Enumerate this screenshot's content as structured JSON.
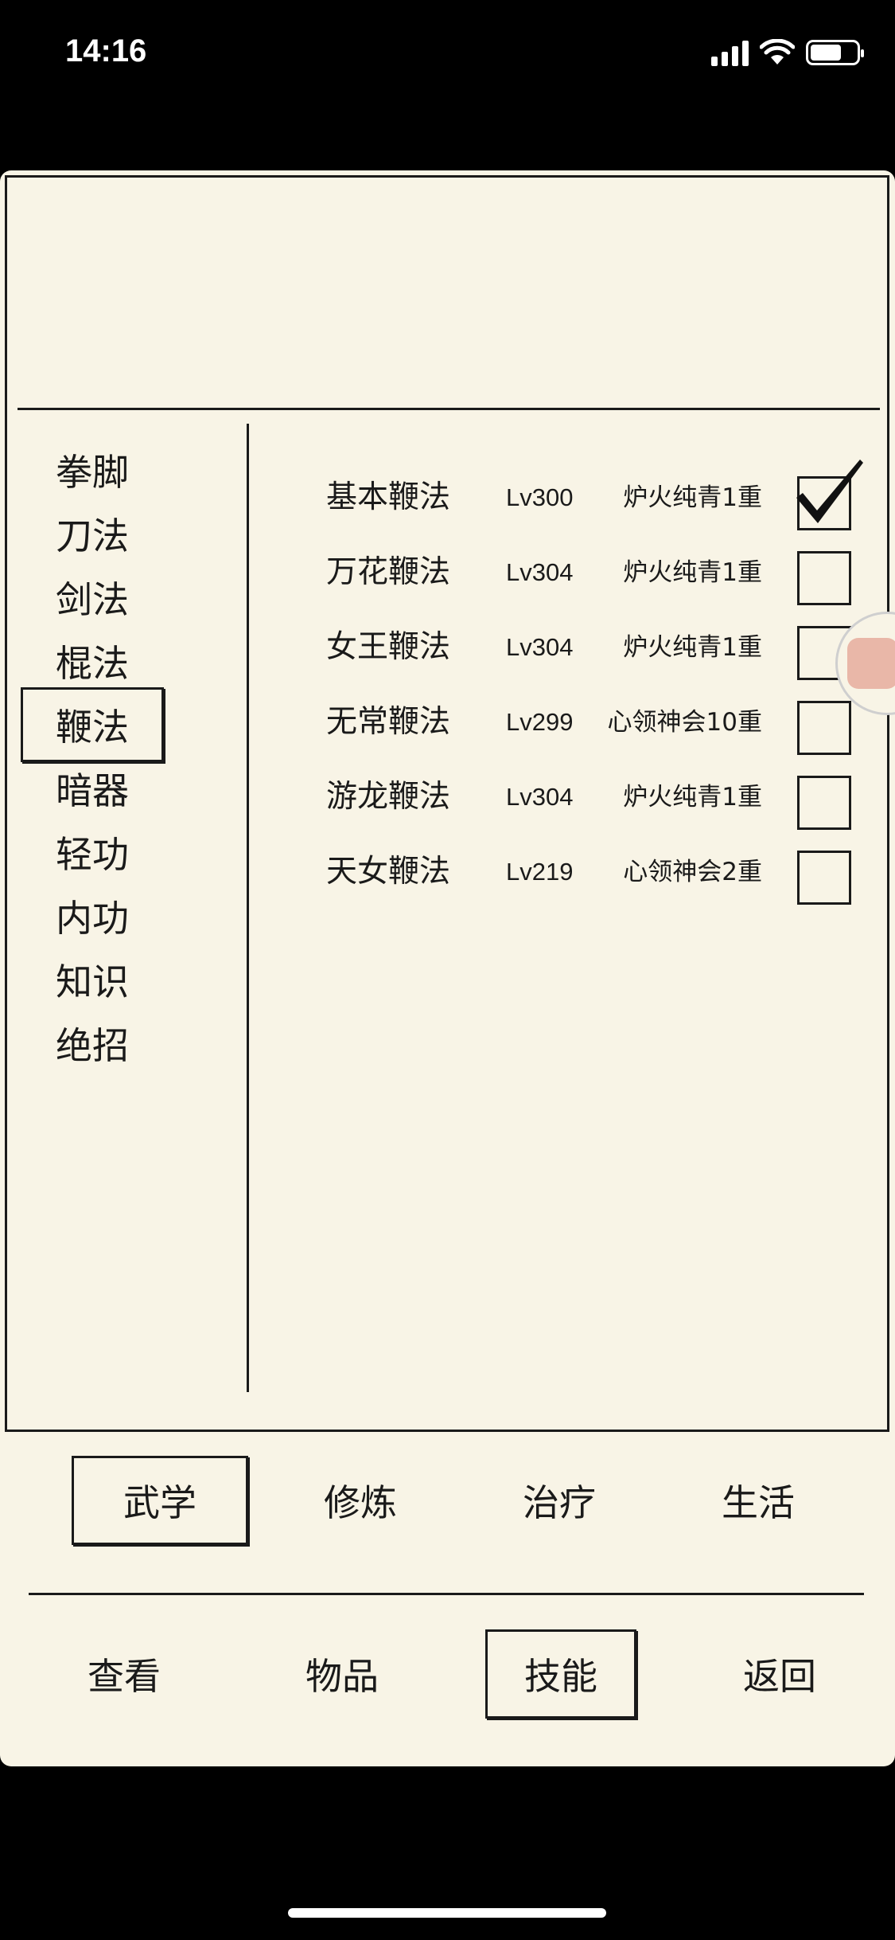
{
  "status_bar": {
    "time": "14:16"
  },
  "categories": [
    "拳脚",
    "刀法",
    "剑法",
    "棍法",
    "鞭法",
    "暗器",
    "轻功",
    "内功",
    "知识",
    "绝招"
  ],
  "active_category_index": 4,
  "skills": [
    {
      "name": "基本鞭法",
      "level": "Lv300",
      "realm": "炉火纯青1重",
      "checked": true
    },
    {
      "name": "万花鞭法",
      "level": "Lv304",
      "realm": "炉火纯青1重",
      "checked": false
    },
    {
      "name": "女王鞭法",
      "level": "Lv304",
      "realm": "炉火纯青1重",
      "checked": false
    },
    {
      "name": "无常鞭法",
      "level": "Lv299",
      "realm": "心领神会10重",
      "checked": false
    },
    {
      "name": "游龙鞭法",
      "level": "Lv304",
      "realm": "炉火纯青1重",
      "checked": false
    },
    {
      "name": "天女鞭法",
      "level": "Lv219",
      "realm": "心领神会2重",
      "checked": false
    }
  ],
  "sub_tabs": [
    "武学",
    "修炼",
    "治疗",
    "生活"
  ],
  "active_sub_tab_index": 0,
  "nav_tabs": [
    "查看",
    "物品",
    "技能",
    "返回"
  ],
  "active_nav_tab_index": 2,
  "colors": {
    "panel_bg": "#f8f4e6",
    "ink": "#1a1a1a",
    "screen_bg": "#000000"
  }
}
